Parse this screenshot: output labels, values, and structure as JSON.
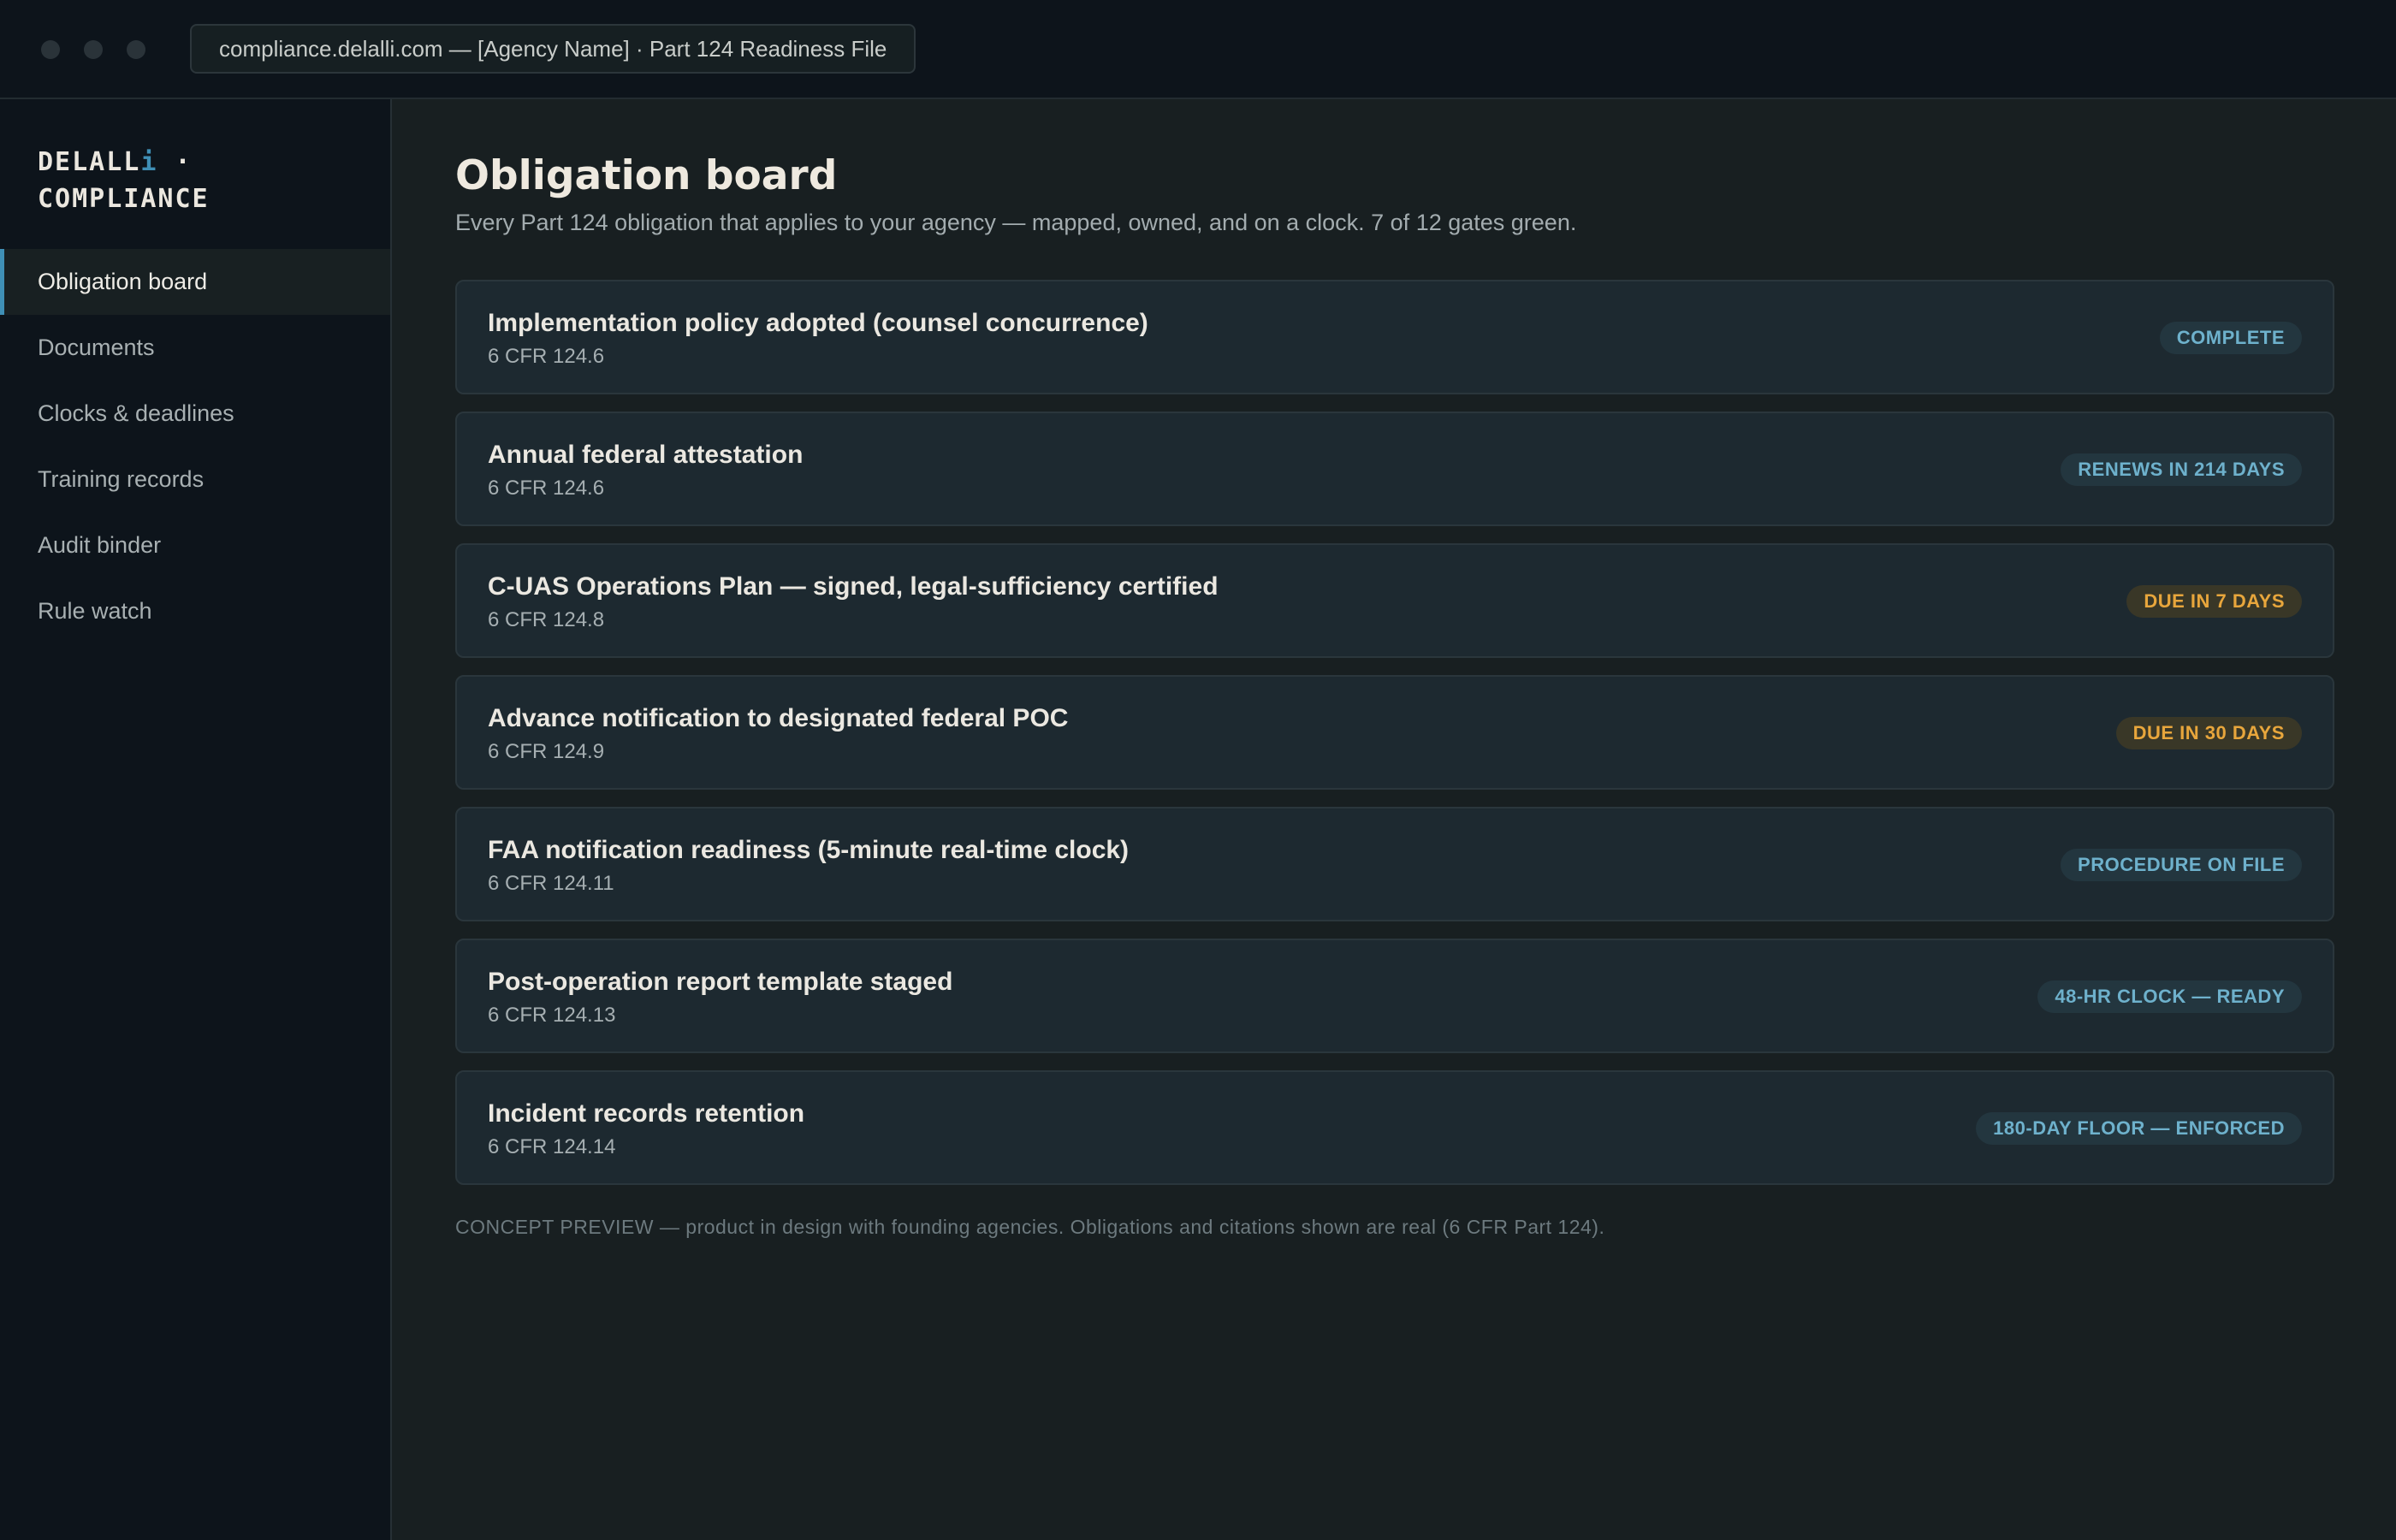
{
  "window": {
    "url_bar": "compliance.delalli.com — [Agency Name] · Part 124 Readiness File"
  },
  "sidebar": {
    "logo": {
      "line1_main": "DELALL",
      "line1_accent": "i",
      "line1_separator": " ·",
      "line2": "COMPLIANCE"
    },
    "items": [
      {
        "label": "Obligation board",
        "active": true
      },
      {
        "label": "Documents",
        "active": false
      },
      {
        "label": "Clocks & deadlines",
        "active": false
      },
      {
        "label": "Training records",
        "active": false
      },
      {
        "label": "Audit binder",
        "active": false
      },
      {
        "label": "Rule watch",
        "active": false
      }
    ]
  },
  "main": {
    "title": "Obligation board",
    "subtitle": "Every Part 124 obligation that applies to your agency — mapped, owned, and on a clock. 7 of 12 gates green.",
    "obligations": [
      {
        "title": "Implementation policy adopted (counsel concurrence)",
        "citation": "6 CFR 124.6",
        "status": "COMPLETE",
        "tone": "info"
      },
      {
        "title": "Annual federal attestation",
        "citation": "6 CFR 124.6",
        "status": "RENEWS IN 214 DAYS",
        "tone": "info"
      },
      {
        "title": "C-UAS Operations Plan — signed, legal-sufficiency certified",
        "citation": "6 CFR 124.8",
        "status": "DUE IN 7 DAYS",
        "tone": "warn"
      },
      {
        "title": "Advance notification to designated federal POC",
        "citation": "6 CFR 124.9",
        "status": "DUE IN 30 DAYS",
        "tone": "warn"
      },
      {
        "title": "FAA notification readiness (5-minute real-time clock)",
        "citation": "6 CFR 124.11",
        "status": "PROCEDURE ON FILE",
        "tone": "info"
      },
      {
        "title": "Post-operation report template staged",
        "citation": "6 CFR 124.13",
        "status": "48-HR CLOCK — READY",
        "tone": "info"
      },
      {
        "title": "Incident records retention",
        "citation": "6 CFR 124.14",
        "status": "180-DAY FLOOR — ENFORCED",
        "tone": "info"
      }
    ],
    "footnote": "CONCEPT PREVIEW — product in design with founding agencies. Obligations and citations shown are real (6 CFR Part 124)."
  },
  "colors": {
    "accent": "#3f8fb5",
    "status_info": "#6eb1cc",
    "status_warn": "#e8a63c"
  }
}
